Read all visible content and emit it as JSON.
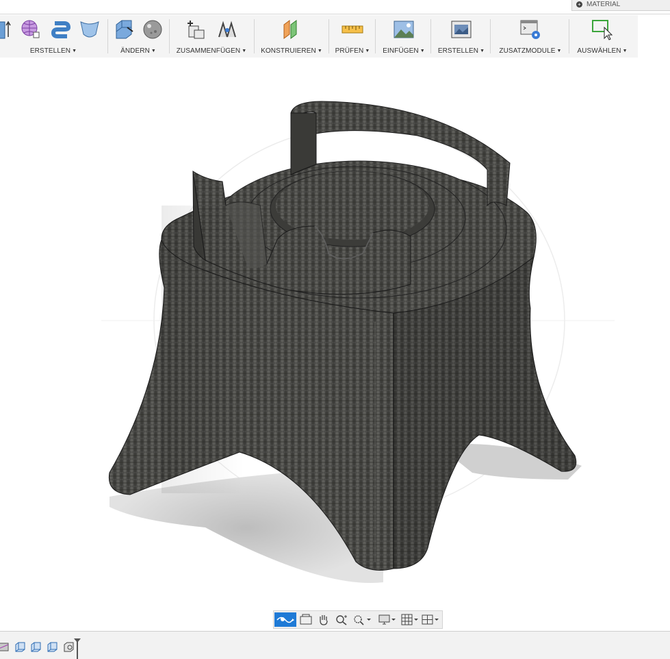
{
  "material_tab": {
    "label": "MATERIAL"
  },
  "toolbar": {
    "groups": [
      {
        "label": "ERSTELLEN"
      },
      {
        "label": "ÄNDERN"
      },
      {
        "label": "ZUSAMMENFÜGEN"
      },
      {
        "label": "KONSTRUIEREN"
      },
      {
        "label": "PRÜFEN"
      },
      {
        "label": "EINFÜGEN"
      },
      {
        "label": "ERSTELLEN"
      },
      {
        "label": "ZUSATZMODULE"
      },
      {
        "label": "AUSWÄHLEN"
      }
    ]
  },
  "viewport": {
    "model": "form-body-stand",
    "material_appearance": "dark woven fabric"
  },
  "navbar": {
    "items": [
      "orbit",
      "look-at",
      "pan",
      "zoom",
      "fit",
      "display-settings",
      "grid-settings",
      "viewports"
    ],
    "active": "orbit"
  },
  "timeline": {
    "items": [
      "form-feature",
      "body-feature",
      "body-feature",
      "body-feature",
      "sketch-feature"
    ]
  },
  "colors": {
    "accent": "#1f7ad6",
    "toolbar_bg": "#f4f4f4",
    "model": "#4a4a47"
  }
}
